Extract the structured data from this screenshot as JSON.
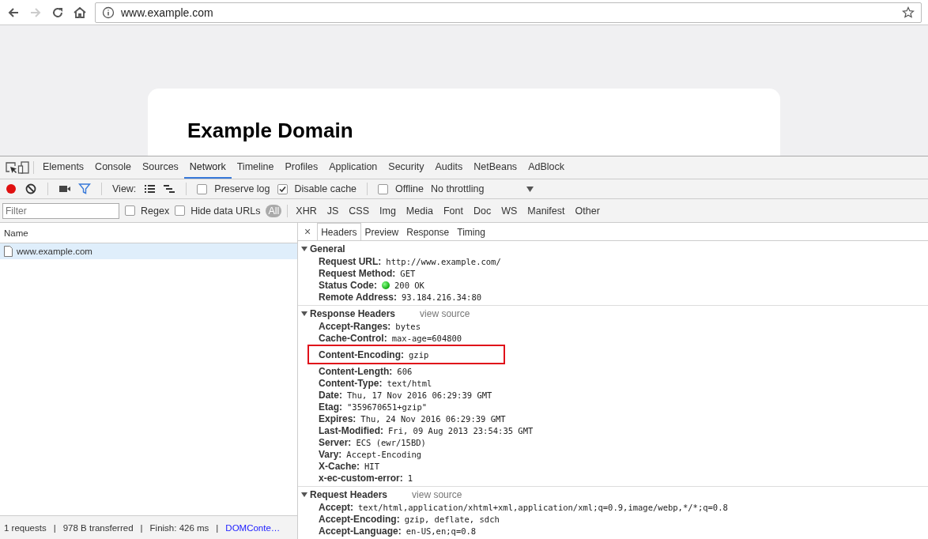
{
  "browser": {
    "url": "www.example.com",
    "forward_disabled": true
  },
  "page": {
    "heading": "Example Domain"
  },
  "devtools": {
    "tabs": [
      {
        "label": "Elements",
        "selected": false
      },
      {
        "label": "Console",
        "selected": false
      },
      {
        "label": "Sources",
        "selected": false
      },
      {
        "label": "Network",
        "selected": true
      },
      {
        "label": "Timeline",
        "selected": false
      },
      {
        "label": "Profiles",
        "selected": false
      },
      {
        "label": "Application",
        "selected": false
      },
      {
        "label": "Security",
        "selected": false
      },
      {
        "label": "Audits",
        "selected": false
      },
      {
        "label": "NetBeans",
        "selected": false
      },
      {
        "label": "AdBlock",
        "selected": false
      }
    ],
    "toolbar": {
      "recording": true,
      "view_label": "View:",
      "options": [
        {
          "label": "Preserve log",
          "checked": false
        },
        {
          "label": "Disable cache",
          "checked": true
        },
        {
          "label": "Offline",
          "checked": false
        }
      ],
      "throttling": "No throttling"
    },
    "filter": {
      "placeholder": "Filter",
      "options": [
        {
          "label": "Regex",
          "checked": false
        },
        {
          "label": "Hide data URLs",
          "checked": false
        }
      ],
      "types": [
        {
          "label": "All",
          "selected": true
        },
        {
          "label": "XHR",
          "selected": false
        },
        {
          "label": "JS",
          "selected": false
        },
        {
          "label": "CSS",
          "selected": false
        },
        {
          "label": "Img",
          "selected": false
        },
        {
          "label": "Media",
          "selected": false
        },
        {
          "label": "Font",
          "selected": false
        },
        {
          "label": "Doc",
          "selected": false
        },
        {
          "label": "WS",
          "selected": false
        },
        {
          "label": "Manifest",
          "selected": false
        },
        {
          "label": "Other",
          "selected": false
        }
      ]
    },
    "requests": {
      "column": "Name",
      "rows": [
        {
          "name": "www.example.com",
          "selected": true
        }
      ]
    },
    "status_bar": [
      {
        "kind": "text",
        "text": "1 requests"
      },
      {
        "kind": "separator",
        "text": "|"
      },
      {
        "kind": "text",
        "text": "978 B transferred"
      },
      {
        "kind": "separator",
        "text": "|"
      },
      {
        "kind": "text",
        "text": "Finish: 426 ms"
      },
      {
        "kind": "separator",
        "text": "|"
      },
      {
        "kind": "link",
        "text": "DOMConte…"
      }
    ],
    "detail": {
      "close": "×",
      "tabs": [
        {
          "label": "Headers",
          "selected": true
        },
        {
          "label": "Preview",
          "selected": false
        },
        {
          "label": "Response",
          "selected": false
        },
        {
          "label": "Timing",
          "selected": false
        }
      ],
      "sections": [
        {
          "title": "General",
          "expanded": true,
          "rows": [
            {
              "kind": "plain",
              "name": "Request URL:",
              "value": "http://www.example.com/",
              "highlighted": false
            },
            {
              "kind": "plain",
              "name": "Request Method:",
              "value": "GET",
              "highlighted": false
            },
            {
              "kind": "status",
              "name": "Status Code:",
              "value": "200 OK",
              "highlighted": false
            },
            {
              "kind": "plain",
              "name": "Remote Address:",
              "value": "93.184.216.34:80",
              "highlighted": false
            }
          ]
        },
        {
          "title": "Response Headers",
          "link": "view source",
          "expanded": true,
          "rows": [
            {
              "kind": "plain",
              "name": "Accept-Ranges:",
              "value": "bytes",
              "highlighted": false
            },
            {
              "kind": "plain",
              "name": "Cache-Control:",
              "value": "max-age=604800",
              "highlighted": false
            },
            {
              "kind": "plain",
              "name": "Content-Encoding:",
              "value": "gzip",
              "highlighted": true
            },
            {
              "kind": "plain",
              "name": "Content-Length:",
              "value": "606",
              "highlighted": false
            },
            {
              "kind": "plain",
              "name": "Content-Type:",
              "value": "text/html",
              "highlighted": false
            },
            {
              "kind": "plain",
              "name": "Date:",
              "value": "Thu, 17 Nov 2016 06:29:39 GMT",
              "highlighted": false
            },
            {
              "kind": "plain",
              "name": "Etag:",
              "value": "\"359670651+gzip\"",
              "highlighted": false
            },
            {
              "kind": "plain",
              "name": "Expires:",
              "value": "Thu, 24 Nov 2016 06:29:39 GMT",
              "highlighted": false
            },
            {
              "kind": "plain",
              "name": "Last-Modified:",
              "value": "Fri, 09 Aug 2013 23:54:35 GMT",
              "highlighted": false
            },
            {
              "kind": "plain",
              "name": "Server:",
              "value": "ECS (ewr/15BD)",
              "highlighted": false
            },
            {
              "kind": "plain",
              "name": "Vary:",
              "value": "Accept-Encoding",
              "highlighted": false
            },
            {
              "kind": "plain",
              "name": "X-Cache:",
              "value": "HIT",
              "highlighted": false
            },
            {
              "kind": "plain",
              "name": "x-ec-custom-error:",
              "value": "1",
              "highlighted": false
            }
          ]
        },
        {
          "title": "Request Headers",
          "link": "view source",
          "expanded": true,
          "rows": [
            {
              "kind": "plain",
              "name": "Accept:",
              "value": "text/html,application/xhtml+xml,application/xml;q=0.9,image/webp,*/*;q=0.8",
              "highlighted": false
            },
            {
              "kind": "plain",
              "name": "Accept-Encoding:",
              "value": "gzip, deflate, sdch",
              "highlighted": false
            },
            {
              "kind": "plain",
              "name": "Accept-Language:",
              "value": "en-US,en;q=0.8",
              "highlighted": false
            }
          ]
        }
      ]
    }
  }
}
